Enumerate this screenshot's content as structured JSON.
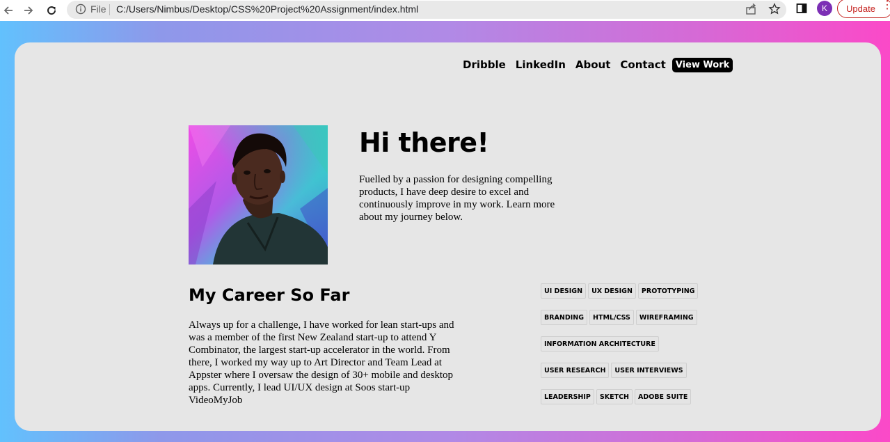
{
  "browser": {
    "file_label": "File",
    "url": "C:/Users/Nimbus/Desktop/CSS%20Project%20Assignment/index.html",
    "profile_initial": "K",
    "update_label": "Update"
  },
  "nav": {
    "items": [
      "Dribble",
      "LinkedIn",
      "About",
      "Contact"
    ],
    "cta": "View Work"
  },
  "hero": {
    "title": "Hi there!",
    "text": "Fuelled by a passion for designing compelling products, I have deep desire to excel and continuously improve in my work. Learn more about my journey below."
  },
  "career": {
    "title": "My Career So Far",
    "text": "Always up for a challenge, I have worked for lean start-ups and was a member of the first New Zealand start-up to attend Y Combinator, the largest start-up accelerator in the world. From there, I worked my way up to Art Director and Team Lead at Appster where I oversaw the design of 30+ mobile and desktop apps. Currently, I lead UI/UX design at Soos start-up VideoMyJob"
  },
  "skills": [
    [
      "UI DESIGN",
      "UX DESIGN",
      "PROTOTYPING"
    ],
    [
      "BRANDING",
      "HTML/CSS",
      "WIREFRAMING"
    ],
    [
      "INFORMATION ARCHITECTURE"
    ],
    [
      "USER RESEARCH",
      "USER INTERVIEWS"
    ],
    [
      "LEADERSHIP",
      "SKETCH",
      "ADOBE SUITE"
    ]
  ],
  "colors": {
    "card_bg": "#e6e6e6",
    "gradient_left": "#62c1fd",
    "gradient_right": "#fb49c8",
    "cta_bg": "#000000",
    "avatar": "#7c2fb5",
    "update": "#c5221f"
  }
}
